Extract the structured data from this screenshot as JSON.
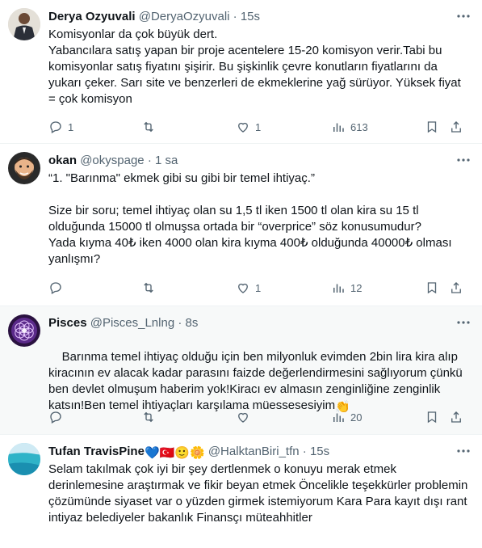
{
  "tweets": [
    {
      "name": "Derya Ozyuvali",
      "handle": "@DeryaOzyuvali",
      "time": "15s",
      "text": "Komisyonlar da çok büyük dert.\nYabancılara satış yapan bir proje acentelere 15-20 komisyon verir.Tabi bu komisyonlar satış fiyatını şişirir. Bu şişkinlik çevre konutların fiyatlarını da yukarı çeker. Sarı site ve benzerleri de ekmeklerine yağ sürüyor. Yüksek fiyat = çok komisyon",
      "replies": "1",
      "retweets": "",
      "likes": "1",
      "views": "613",
      "avatar": "man-in-suit-photo"
    },
    {
      "name": "okan",
      "handle": "@okyspage",
      "time": "1 sa",
      "text": "“1. \"Barınma\" ekmek gibi su gibi bir temel ihtiyaç.”\n\nSize bir soru; temel ihtiyaç olan su 1,5 tl iken 1500 tl olan kira su 15 tl olduğunda 15000 tl olmuşsa ortada bir “overprice” söz konusumudur?\nYada kıyma 40₺ iken 4000 olan kira kıyma 400₺ olduğunda 40000₺ olması yanlışmı?",
      "replies": "",
      "retweets": "",
      "likes": "1",
      "views": "12",
      "avatar": "memoji-man-with-beard"
    },
    {
      "name": "Pisces",
      "handle": "@Pisces_Lnlng",
      "time": "8s",
      "text": "Barınma temel ihtiyaç olduğu için ben milyonluk evimden 2bin lira kira alıp kiracının ev alacak kadar parasını faizde değerlendirmesini sağlıyorum çünkü ben devlet olmuşum haberim yok!Kiracı ev almasın zenginliğine zenginlik katsın!Ben temel ihtiyaçları karşılama müessesesiyim",
      "emoji": "👏",
      "replies": "",
      "retweets": "",
      "likes": "",
      "views": "20",
      "avatar": "purple-flower-of-life"
    },
    {
      "name": "Tufan TravisPine",
      "name_emojis": "💙🇹🇷🙂🌼",
      "handle": "@HalktanBiri_tfn",
      "time": "15s",
      "text": "Selam takılmak çok iyi bir şey dertlenmek o konuyu merak etmek derinlemesine araştırmak ve fikir beyan etmek Öncelikle teşekkürler problemin çözümünde siyaset var o yüzden girmek istemiyorum Kara Para kayıt dışı rant intiyaz belediyeler bakanlık Finansçı müteahhitler",
      "avatar": "turquoise-sea-photo"
    }
  ]
}
